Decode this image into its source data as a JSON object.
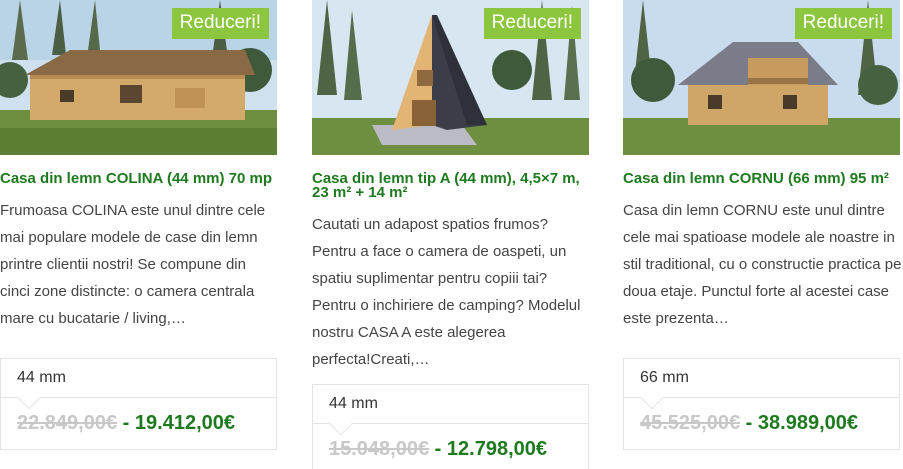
{
  "badge_label": "Reduceri!",
  "colors": {
    "accent": "#1e7a1e",
    "badge": "#8cc63f",
    "old_price": "#c8c8c8"
  },
  "products": [
    {
      "title": "Casa din lemn COLINA (44 mm) 70 mp",
      "description": "Frumoasa COLINA este unul dintre cele mai populare modele de case din lemn printre clientii nostri! Se compune din cinci zone distincte: o camera centrala mare cu bucatarie / living,…",
      "variant": "44 mm",
      "old_price": "22.849,00€",
      "separator": "-",
      "new_price": "19.412,00€"
    },
    {
      "title": "Casa din lemn tip A (44 mm), 4,5×7 m, 23 m² + 14 m²",
      "description": "Cautati un adapost spatios frumos? Pentru a face o camera de oaspeti, un spatiu suplimentar pentru copiii tai? Pentru o inchiriere de camping? Modelul nostru CASA A este alegerea perfecta!Creati,…",
      "variant": "44 mm",
      "old_price": "15.048,00€",
      "separator": "-",
      "new_price": "12.798,00€"
    },
    {
      "title": "Casa din lemn CORNU (66 mm) 95 m²",
      "description": "Casa din lemn CORNU este unul dintre cele mai spatioase modele ale noastre in stil traditional, cu o constructie practica pe doua etaje. Punctul forte al acestei case este prezenta…",
      "variant": "66 mm",
      "old_price": "45.525,00€",
      "separator": "-",
      "new_price": "38.989,00€"
    }
  ]
}
